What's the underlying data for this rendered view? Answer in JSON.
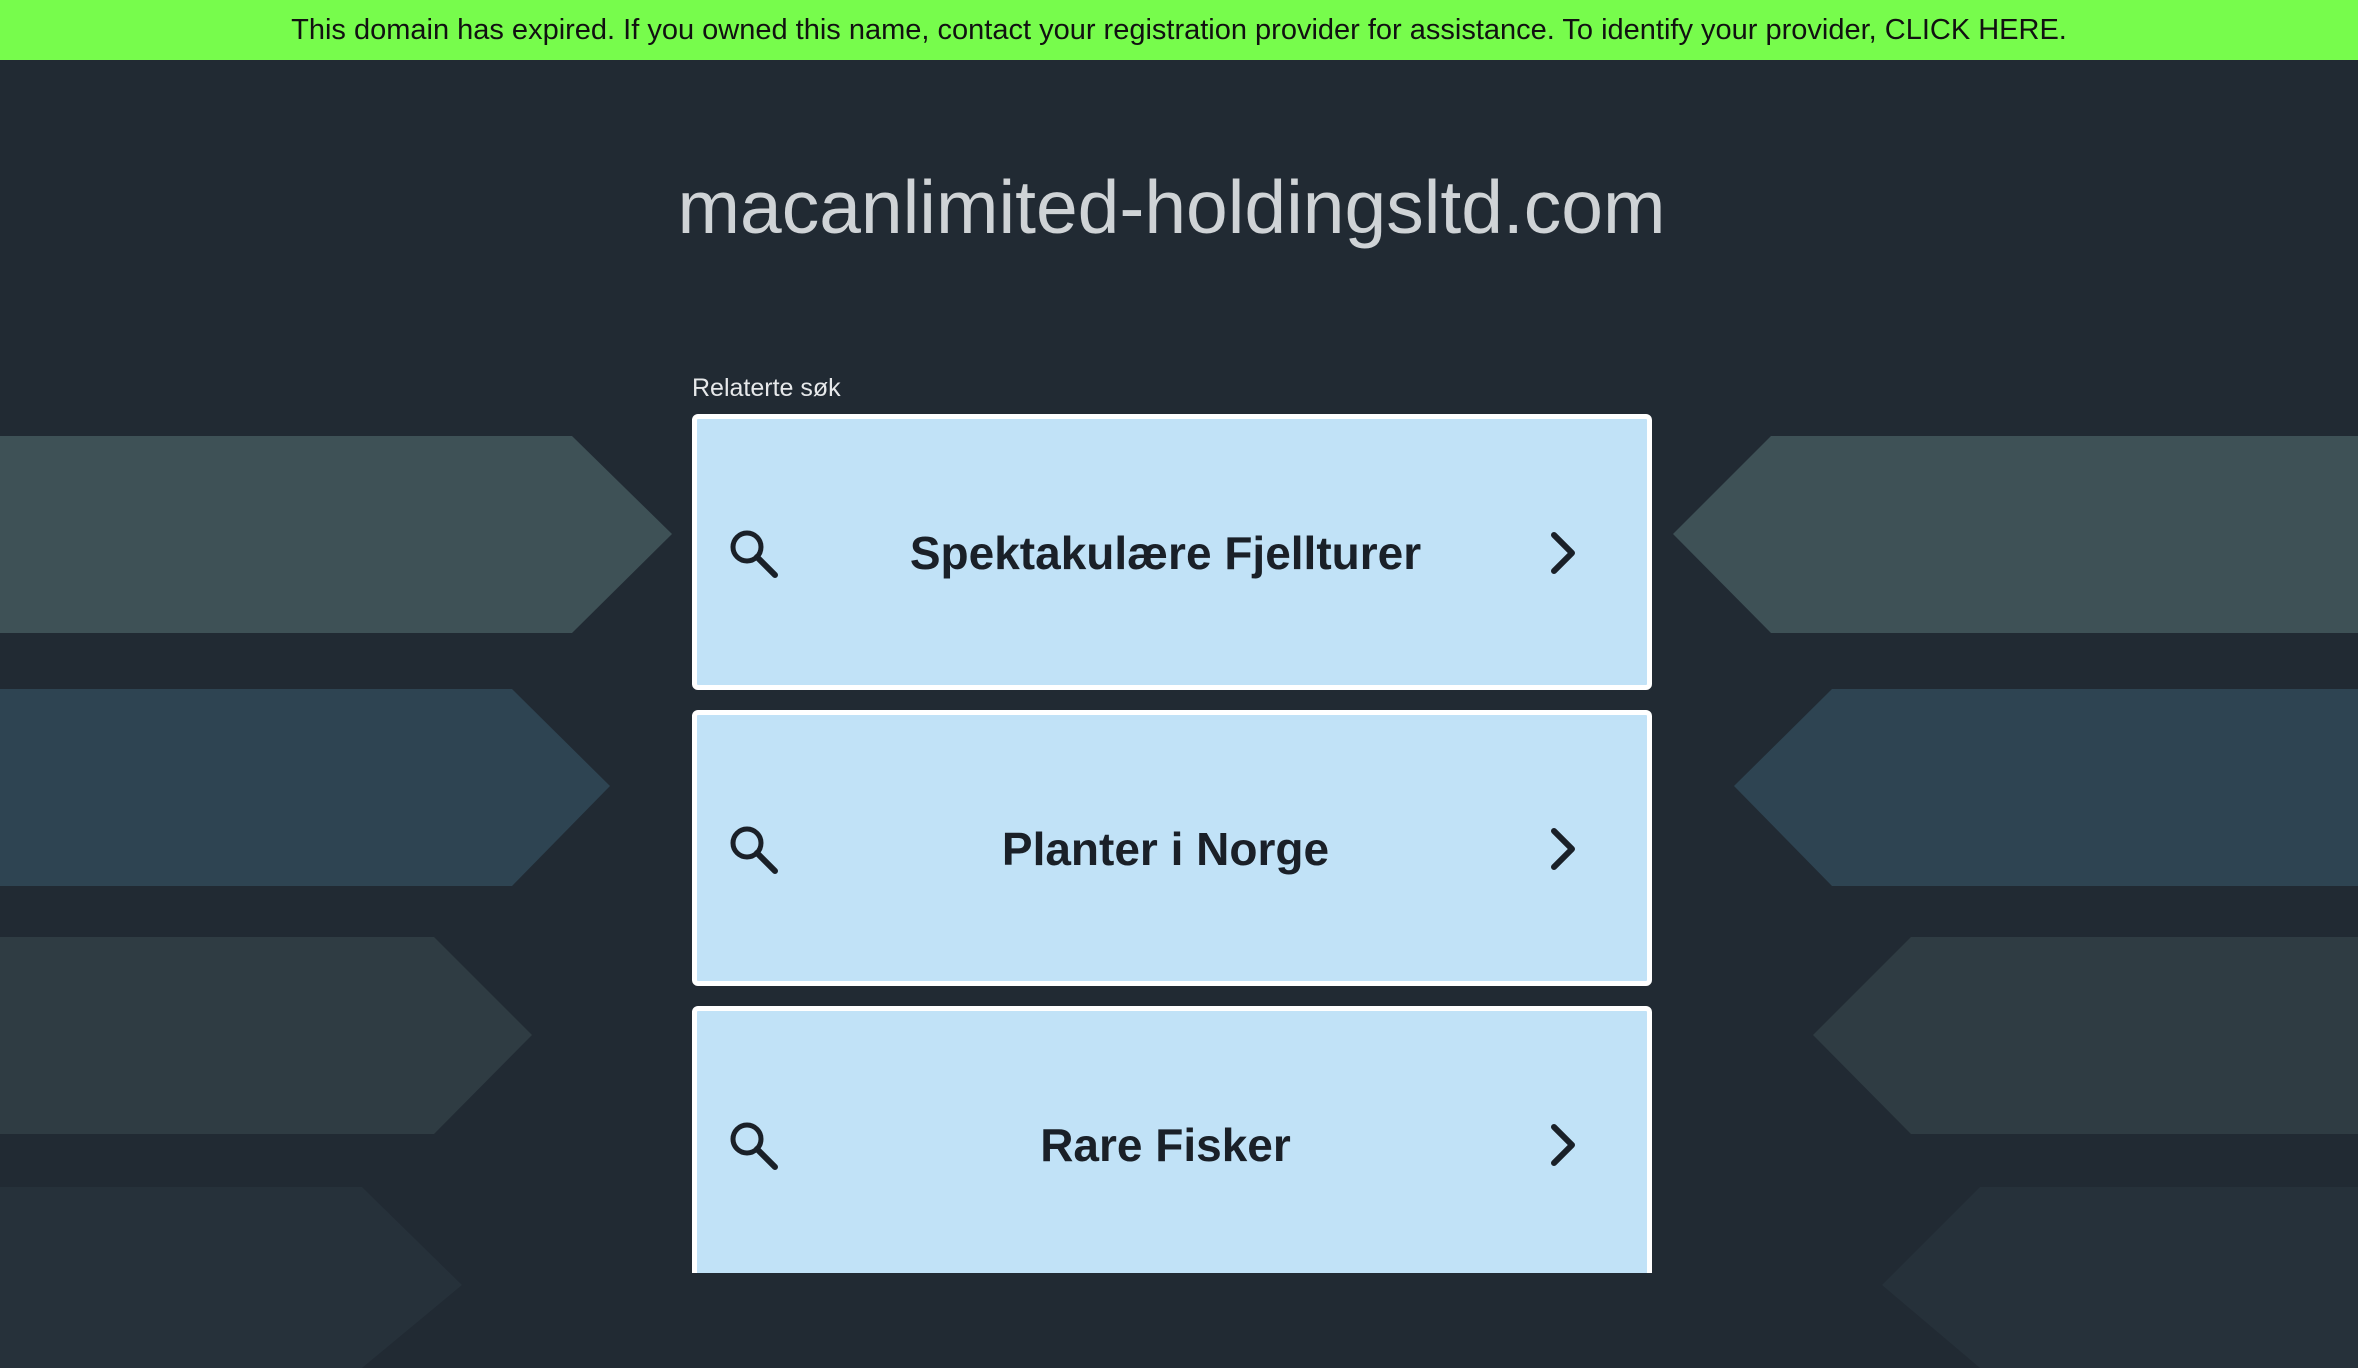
{
  "banner": {
    "text": "This domain has expired. If you owned this name, contact your registration provider for assistance. To identify your provider, CLICK HERE."
  },
  "domain": {
    "name": "macanlimited-holdingsltd.com"
  },
  "related": {
    "label": "Relaterte søk",
    "items": [
      {
        "label": "Spektakulære Fjellturer"
      },
      {
        "label": "Planter i Norge"
      },
      {
        "label": "Rare Fisker"
      }
    ]
  },
  "colors": {
    "background": "#212a33",
    "banner": "#77fc4c",
    "card": "#c1e2f7",
    "card_border": "#ffffff",
    "title_text": "#cfd3d6"
  },
  "icons": {
    "search": "search-icon",
    "chevron": "chevron-right-icon"
  }
}
